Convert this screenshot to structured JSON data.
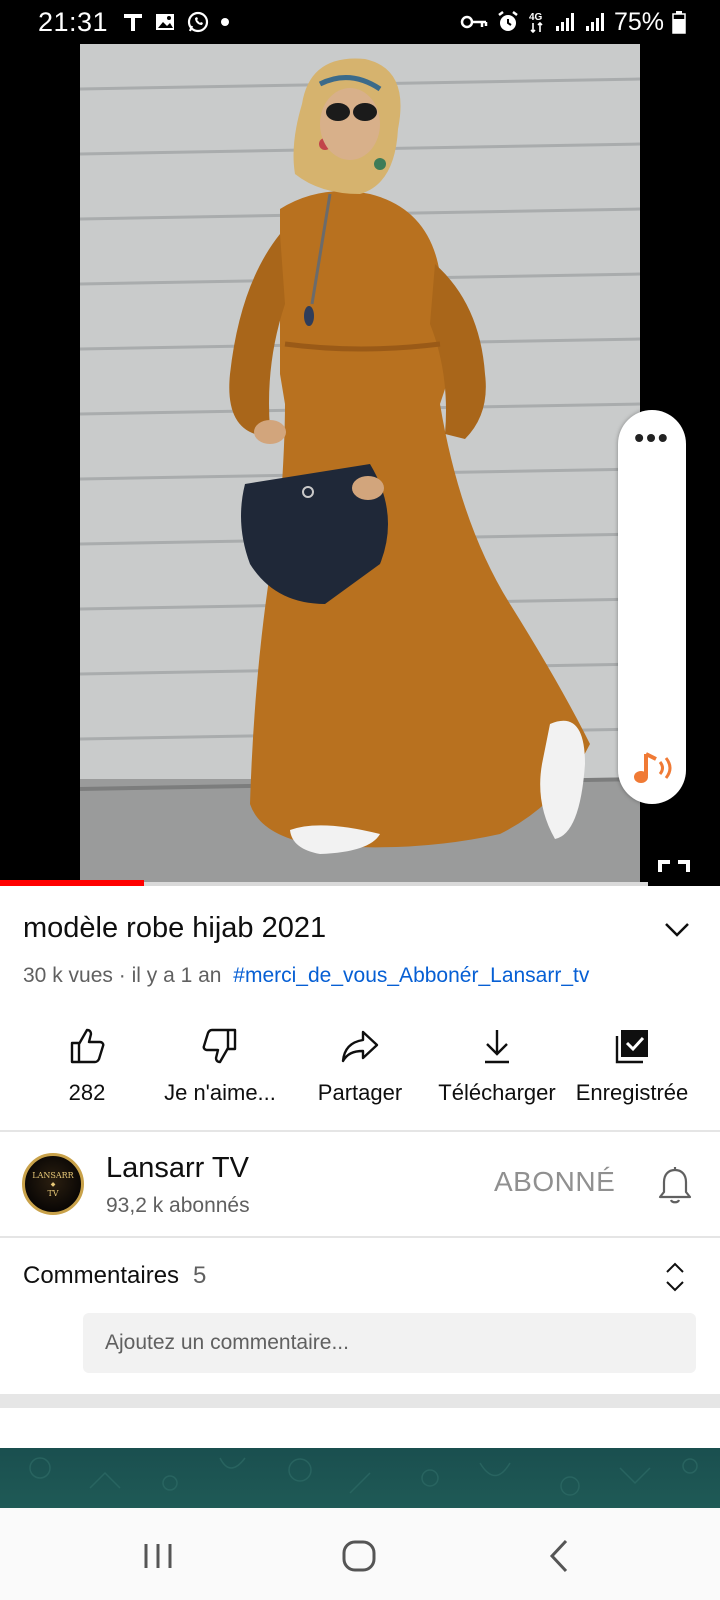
{
  "status_bar": {
    "time": "21:31",
    "left_icons": [
      "t-icon",
      "gallery-icon",
      "whatsapp-icon",
      "dot-icon"
    ],
    "right_icons": [
      "vpn-key-icon",
      "alarm-icon",
      "4g-icon",
      "signal-icon",
      "signal-icon"
    ],
    "network": "4G",
    "battery": "75%"
  },
  "video": {
    "progress_fraction": 0.2,
    "accent_color": "#ff0000"
  },
  "edge_panel": {
    "menu_label": "•••",
    "icon": "music-note-icon"
  },
  "title": "modèle robe hijab 2021",
  "meta": {
    "views": "30 k vues",
    "separator": " · ",
    "age": "il y a 1 an",
    "hashtag": "#merci_de_vous_Abbonér_Lansarr_tv"
  },
  "actions": [
    {
      "icon": "thumbs-up-icon",
      "label": "282"
    },
    {
      "icon": "thumbs-down-icon",
      "label": "Je n'aime..."
    },
    {
      "icon": "share-icon",
      "label": "Partager"
    },
    {
      "icon": "download-icon",
      "label": "Télécharger"
    },
    {
      "icon": "saved-icon",
      "label": "Enregistrée"
    }
  ],
  "channel": {
    "avatar_text_top": "LANSARR",
    "avatar_text_bottom": "TV",
    "name": "Lansarr TV",
    "subscribers": "93,2 k abonnés",
    "subscribe_label": "ABONNÉ"
  },
  "comments": {
    "label": "Commentaires",
    "count": "5",
    "placeholder": "Ajoutez un commentaire..."
  },
  "nav": {
    "buttons": [
      "recent-apps-icon",
      "home-icon",
      "back-icon"
    ]
  }
}
